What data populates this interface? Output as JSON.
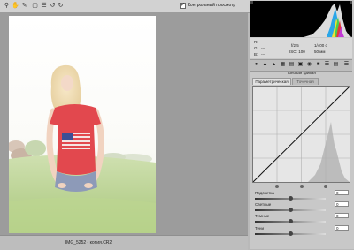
{
  "toolbar": {
    "tools": [
      "zoom-icon",
      "hand-icon",
      "white-balance-icon",
      "crop-icon",
      "list-icon",
      "rotate-ccw-icon",
      "rotate-cw-icon"
    ],
    "preview_checked": true,
    "preview_label": "Контрольный просмотр"
  },
  "statusbar": {
    "filename": "IMG_5252 - копия.CR2"
  },
  "info": {
    "r_label": "R:",
    "g_label": "G:",
    "b_label": "B:",
    "r_value": "---",
    "g_value": "---",
    "b_value": "---",
    "aperture": "f/2,5",
    "shutter": "1/400 с",
    "iso": "ISO: 100",
    "focal": "50 мм"
  },
  "panel": {
    "section_title": "Тоновая кривая",
    "tabs": [
      "Параметрическая",
      "Точечная"
    ],
    "active_tab": 0
  },
  "sliders": [
    {
      "label": "Подсветка",
      "value": "0",
      "position": 0.5
    },
    {
      "label": "Светлые",
      "value": "0",
      "position": 0.5
    },
    {
      "label": "Темные",
      "value": "0",
      "position": 0.5
    },
    {
      "label": "Тени",
      "value": "0",
      "position": 0.5
    }
  ],
  "colors": {
    "accent": "#6a8fcf",
    "shirt": "#e2484e",
    "grass": "#b9d38f"
  }
}
